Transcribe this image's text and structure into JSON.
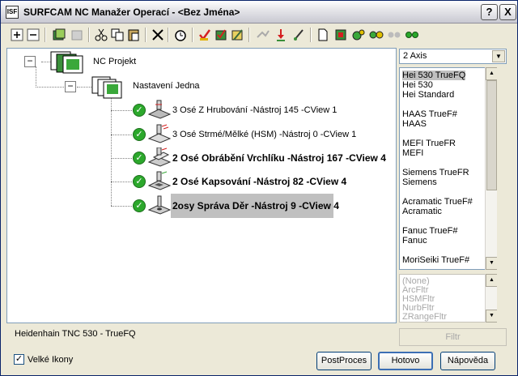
{
  "window": {
    "title": "SURFCAM NC Manažer Operací - <Bez Jména>",
    "app_icon_text": "ISF",
    "help_label": "?",
    "close_label": "X"
  },
  "toolbar": {
    "icons": [
      "expand-all-icon",
      "collapse-all-icon",
      "new-folder-icon",
      "folder-disabled-icon",
      "cut-icon",
      "copy-icon",
      "paste-icon",
      "delete-icon",
      "time-icon",
      "verify-icon",
      "properties-icon",
      "edit-icon",
      "disabled-tool-icon",
      "sort-icon",
      "tool-edit-icon",
      "document-icon",
      "post-icon",
      "operation-icon",
      "operation-pair-icon",
      "green-dots-disabled-icon",
      "green-dots-icon"
    ]
  },
  "tree": {
    "root": {
      "label": "NC Projekt",
      "expander": "−"
    },
    "setup": {
      "label": "Nastavení Jedna",
      "expander": "−"
    },
    "operations": [
      {
        "label": "3 Osé Z Hrubování  -Nástroj 145 -CView 1",
        "bold": false,
        "status": "✓"
      },
      {
        "label": "3 Osé Strmé/Mělké (HSM)  -Nástroj 0 -CView 1",
        "bold": false,
        "status": "✓"
      },
      {
        "label": "2 Osé Obrábění Vrchlíku  -Nástroj 167 -CView 4",
        "bold": true,
        "status": "✓"
      },
      {
        "label": "2 Osé Kapsování   -Nástroj 82 -CView 4",
        "bold": true,
        "status": "✓"
      },
      {
        "label": "2osy Správa Děr  -Nástroj 9 -CView 4",
        "bold": true,
        "selected": true,
        "status": "✓"
      }
    ]
  },
  "axis_select": {
    "value": "2 Axis",
    "arrow": "▼"
  },
  "post_list": {
    "items": [
      "Hei 530 TrueFQ",
      "Hei 530",
      "Hei Standard",
      "",
      "HAAS TrueF#",
      "HAAS",
      "",
      "MEFI TrueFR",
      "MEFI",
      "",
      "Siemens TrueFR",
      "Siemens",
      "",
      "Acramatic TrueF#",
      "Acramatic",
      "",
      "Fanuc TrueF#",
      "Fanuc",
      "",
      "MoriSeiki TrueF#"
    ],
    "selected_index": 0
  },
  "filter_list": {
    "items": [
      "(None)",
      "ArcFltr",
      "HSMFltr",
      "NurbFltr",
      "ZRangeFltr"
    ]
  },
  "scroll": {
    "up": "▲",
    "down": "▼",
    "grip": "≡"
  },
  "filter_button": "Filtr",
  "status_text": "Heidenhain TNC 530 - TrueFQ",
  "large_icons": {
    "label": "Velké Ikony",
    "checked": true,
    "mark": "✓"
  },
  "buttons": {
    "postproces": "PostProces",
    "ok": "Hotovo",
    "help": "Nápověda"
  }
}
